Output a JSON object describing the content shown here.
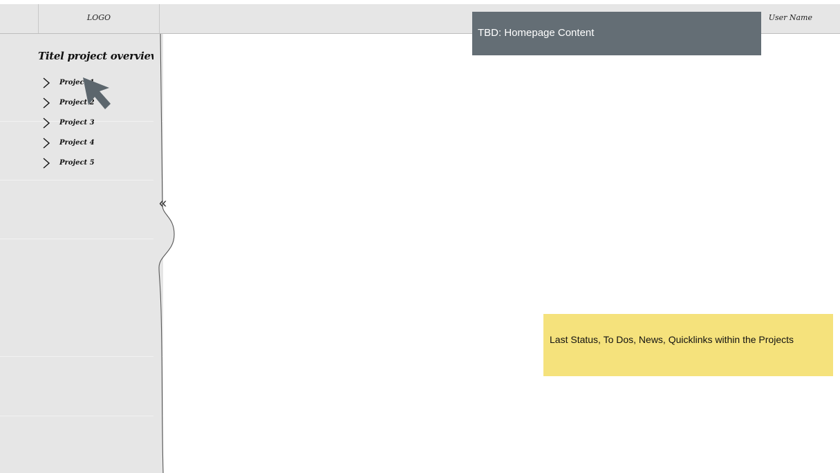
{
  "header": {
    "logo": "LOGO",
    "user_name": "User Name"
  },
  "sidebar": {
    "title": "Titel project overview",
    "items": [
      {
        "label": "Project 1"
      },
      {
        "label": "Project 2"
      },
      {
        "label": "Project 3"
      },
      {
        "label": "Project 4"
      },
      {
        "label": "Project 5"
      }
    ],
    "collapse_glyph": "«"
  },
  "main": {
    "tbd_note": "TBD: Homepage Content",
    "sticky_note": "Last Status, To Dos, News, Quicklinks within the Projects"
  },
  "colors": {
    "tbd_box": "#646e75",
    "sticky_note": "#f5e27c",
    "sidebar_bg": "#e6e6e6"
  },
  "icons": [
    "chevron-right-icon",
    "cursor-arrow-icon",
    "collapse-double-chevron-icon"
  ]
}
